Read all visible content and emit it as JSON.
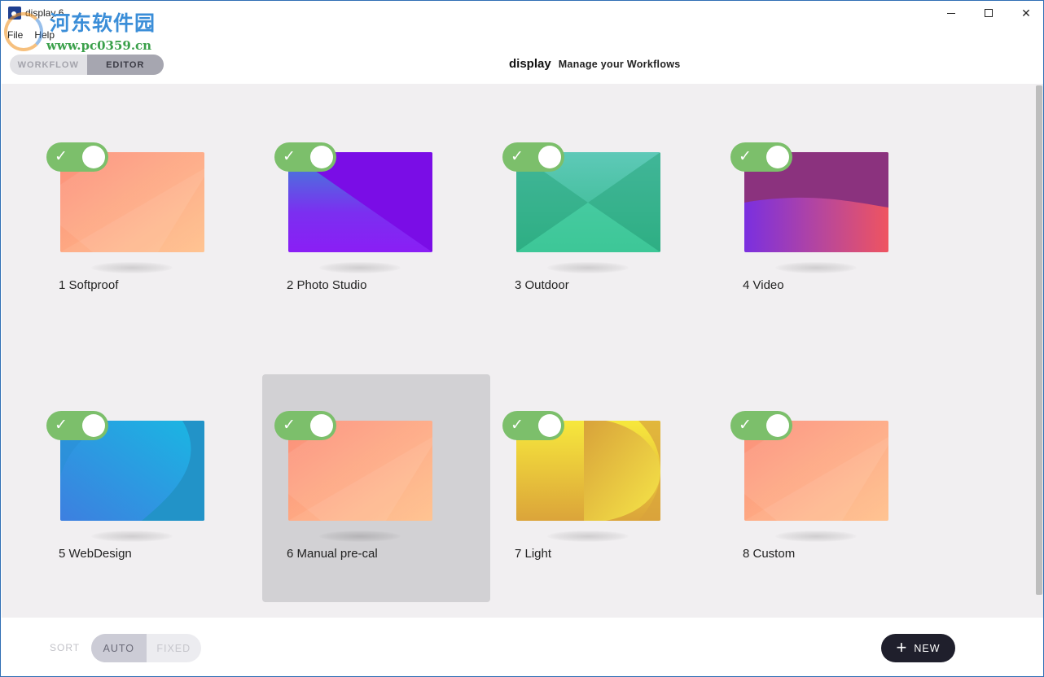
{
  "window": {
    "title": "display 6",
    "controls": {
      "minimize": "minimize",
      "maximize": "maximize",
      "close": "✕"
    }
  },
  "watermark": {
    "cn": "河东软件园",
    "url": "www.pc0359.cn"
  },
  "menu": {
    "items": [
      "File",
      "Help"
    ]
  },
  "header": {
    "modes": [
      "WORKFLOW",
      "EDITOR"
    ],
    "active_mode": "EDITOR",
    "brand": "display",
    "subtitle": "Manage your Workflows"
  },
  "workflows": [
    {
      "label": "1 Softproof",
      "enabled": true,
      "selected": false,
      "theme": "peach"
    },
    {
      "label": "2 Photo Studio",
      "enabled": true,
      "selected": false,
      "theme": "purple"
    },
    {
      "label": "3 Outdoor",
      "enabled": true,
      "selected": false,
      "theme": "green"
    },
    {
      "label": "4 Video",
      "enabled": true,
      "selected": false,
      "theme": "magenta"
    },
    {
      "label": "5 WebDesign",
      "enabled": true,
      "selected": false,
      "theme": "blue"
    },
    {
      "label": "6 Manual pre-cal",
      "enabled": true,
      "selected": true,
      "theme": "peach"
    },
    {
      "label": "7 Light",
      "enabled": true,
      "selected": false,
      "theme": "yellow"
    },
    {
      "label": "8 Custom",
      "enabled": true,
      "selected": false,
      "theme": "peach"
    }
  ],
  "footer": {
    "sort_label": "SORT",
    "sort_options": [
      "AUTO",
      "FIXED"
    ],
    "active_sort": "AUTO",
    "new_label": "NEW"
  },
  "colors": {
    "toggle_on": "#7cbf6b",
    "new_button": "#1f1f2c",
    "content_bg": "#f1eff1",
    "selected_card": "#d2d1d4"
  },
  "icons": {
    "check": "check-icon",
    "plus": "plus-icon",
    "app": "app-logo-icon"
  }
}
